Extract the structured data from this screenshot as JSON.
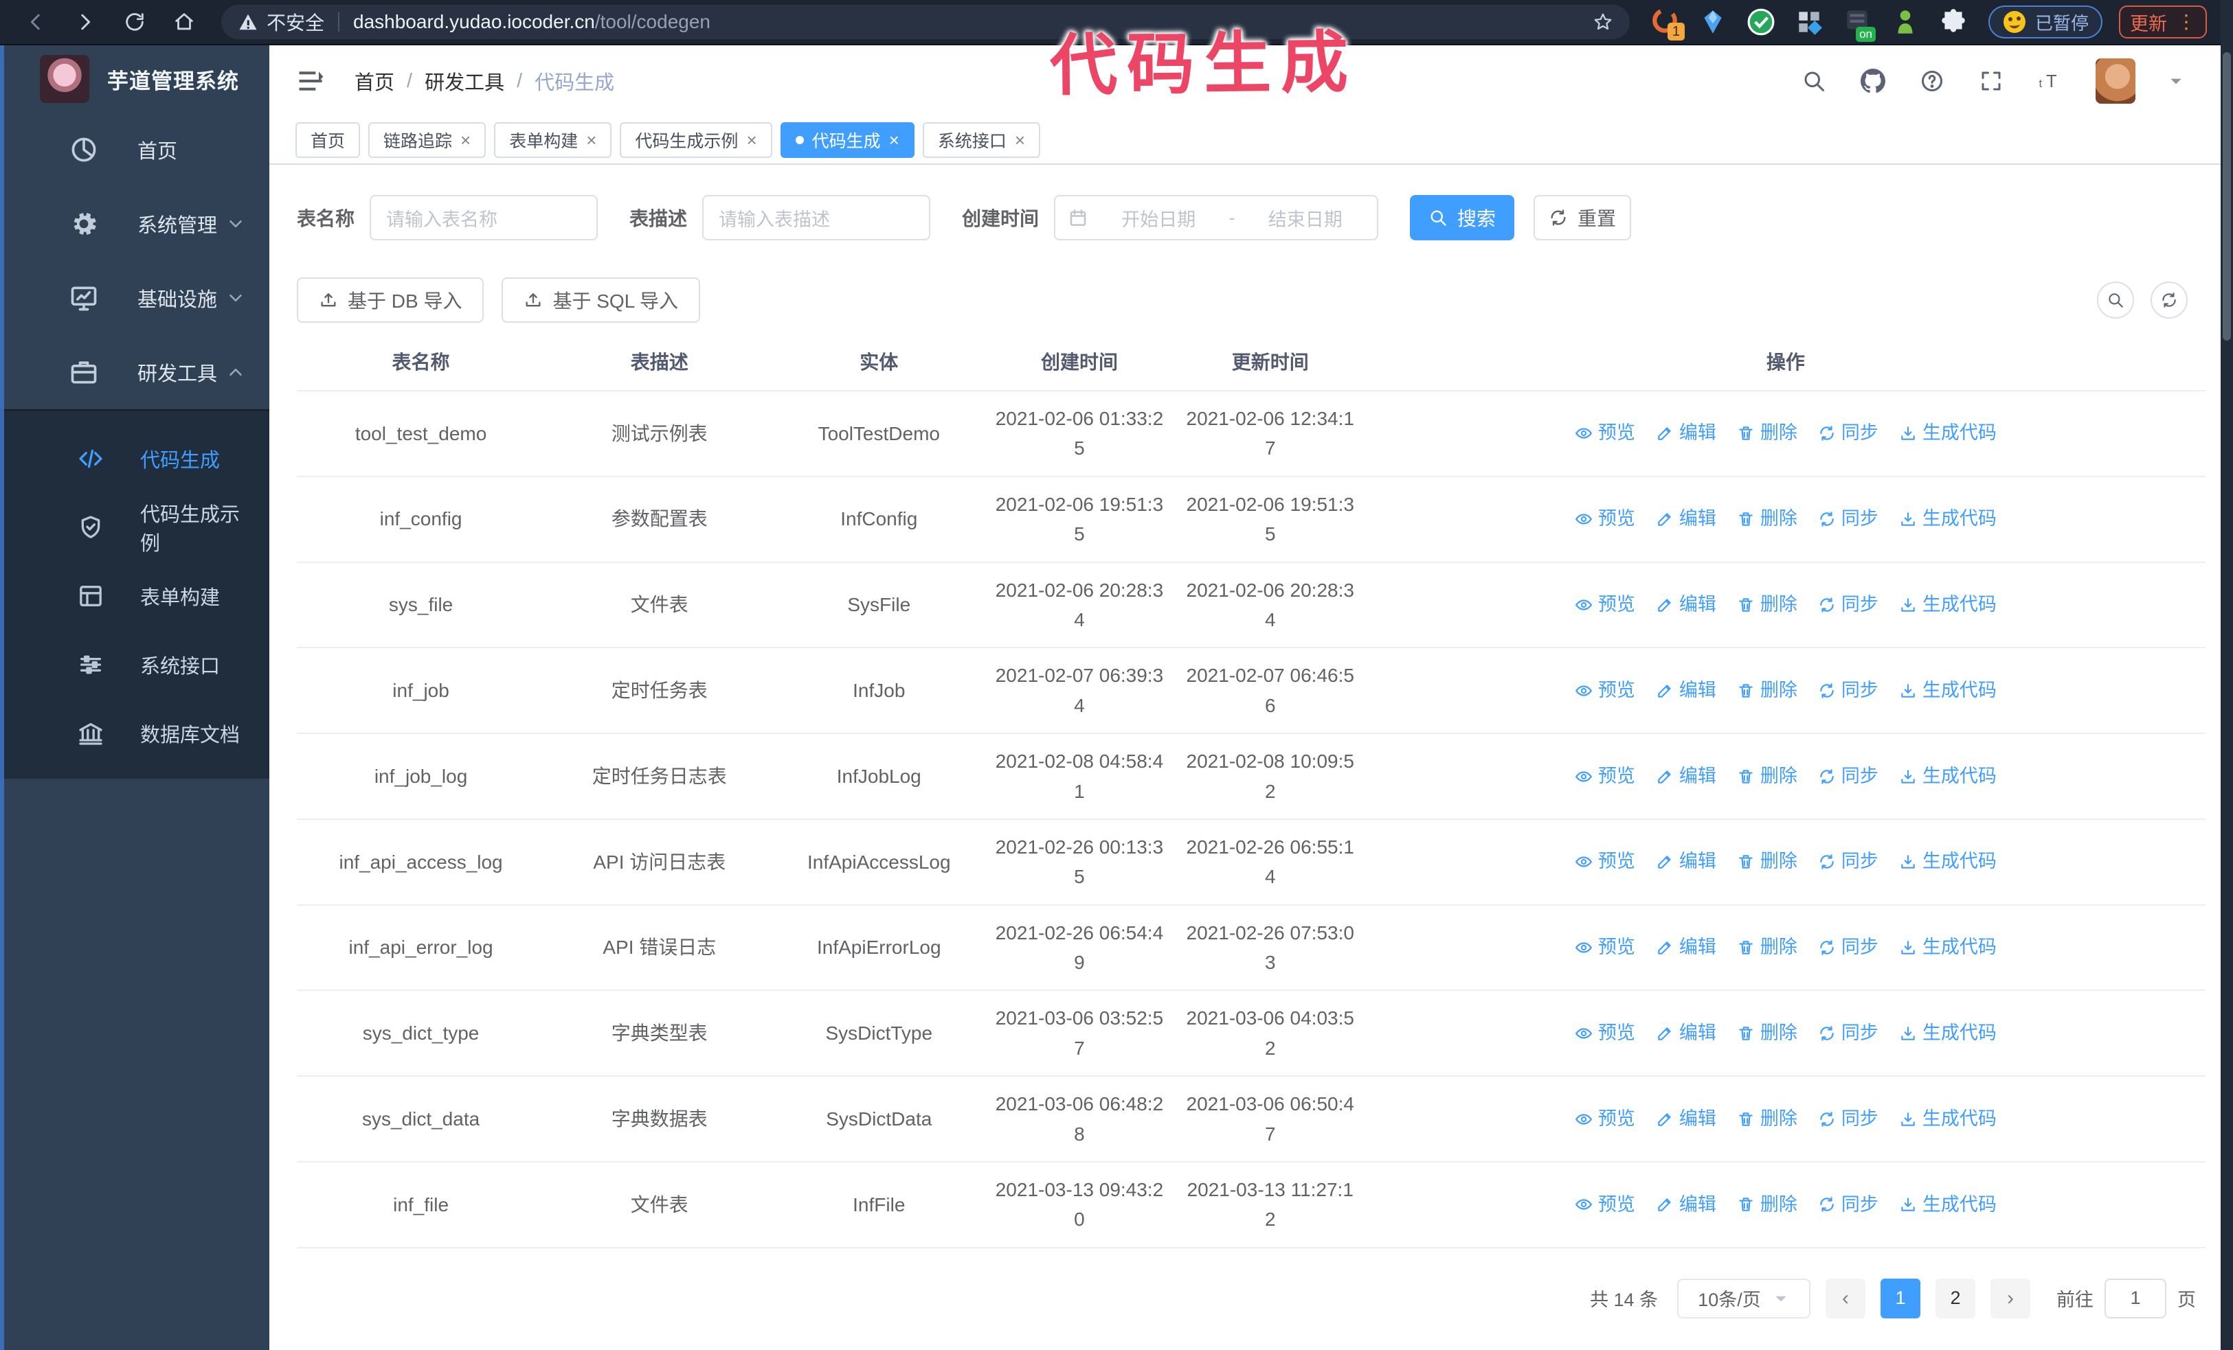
{
  "annotation": {
    "text": "代码生成"
  },
  "browser": {
    "security_label": "不安全",
    "url_host": "dashboard.yudao.iocoder.cn",
    "url_path": "/tool/codegen",
    "extensions": {
      "badge_count": "1",
      "on_label": "on"
    },
    "paused_label": "已暂停",
    "update_label": "更新"
  },
  "sidebar": {
    "logo_title": "芋道管理系统",
    "items": [
      {
        "label": "首页",
        "icon": "dashboard"
      },
      {
        "label": "系统管理",
        "icon": "gear",
        "chevron": "down"
      },
      {
        "label": "基础设施",
        "icon": "monitor",
        "chevron": "down"
      },
      {
        "label": "研发工具",
        "icon": "briefcase",
        "chevron": "up"
      }
    ],
    "submenu": [
      {
        "label": "代码生成",
        "icon": "code",
        "active": true
      },
      {
        "label": "代码生成示例",
        "icon": "shield",
        "active": false
      },
      {
        "label": "表单构建",
        "icon": "form",
        "active": false
      },
      {
        "label": "系统接口",
        "icon": "sliders",
        "active": false
      },
      {
        "label": "数据库文档",
        "icon": "bank",
        "active": false
      }
    ]
  },
  "header": {
    "breadcrumb": [
      "首页",
      "研发工具",
      "代码生成"
    ]
  },
  "tabs": [
    {
      "label": "首页",
      "closable": false,
      "active": false
    },
    {
      "label": "链路追踪",
      "closable": true,
      "active": false
    },
    {
      "label": "表单构建",
      "closable": true,
      "active": false
    },
    {
      "label": "代码生成示例",
      "closable": true,
      "active": false
    },
    {
      "label": "代码生成",
      "closable": true,
      "active": true
    },
    {
      "label": "系统接口",
      "closable": true,
      "active": false
    }
  ],
  "filters": {
    "name_label": "表名称",
    "name_placeholder": "请输入表名称",
    "desc_label": "表描述",
    "desc_placeholder": "请输入表描述",
    "time_label": "创建时间",
    "start_placeholder": "开始日期",
    "range_separator": "-",
    "end_placeholder": "结束日期",
    "search_label": "搜索",
    "reset_label": "重置"
  },
  "toolbar": {
    "db_import_label": "基于 DB 导入",
    "sql_import_label": "基于 SQL 导入"
  },
  "table": {
    "columns": [
      "表名称",
      "表描述",
      "实体",
      "创建时间",
      "更新时间",
      "操作"
    ],
    "action_labels": [
      "预览",
      "编辑",
      "删除",
      "同步",
      "生成代码"
    ],
    "action_icons": [
      "eye",
      "edit",
      "trash",
      "sync",
      "download"
    ],
    "rows": [
      {
        "name": "tool_test_demo",
        "desc": "测试示例表",
        "entity": "ToolTestDemo",
        "created": "2021-02-06 01:33:25",
        "updated": "2021-02-06 12:34:17"
      },
      {
        "name": "inf_config",
        "desc": "参数配置表",
        "entity": "InfConfig",
        "created": "2021-02-06 19:51:35",
        "updated": "2021-02-06 19:51:35"
      },
      {
        "name": "sys_file",
        "desc": "文件表",
        "entity": "SysFile",
        "created": "2021-02-06 20:28:34",
        "updated": "2021-02-06 20:28:34"
      },
      {
        "name": "inf_job",
        "desc": "定时任务表",
        "entity": "InfJob",
        "created": "2021-02-07 06:39:34",
        "updated": "2021-02-07 06:46:56"
      },
      {
        "name": "inf_job_log",
        "desc": "定时任务日志表",
        "entity": "InfJobLog",
        "created": "2021-02-08 04:58:41",
        "updated": "2021-02-08 10:09:52"
      },
      {
        "name": "inf_api_access_log",
        "desc": "API 访问日志表",
        "entity": "InfApiAccessLog",
        "created": "2021-02-26 00:13:35",
        "updated": "2021-02-26 06:55:14"
      },
      {
        "name": "inf_api_error_log",
        "desc": "API 错误日志",
        "entity": "InfApiErrorLog",
        "created": "2021-02-26 06:54:49",
        "updated": "2021-02-26 07:53:03"
      },
      {
        "name": "sys_dict_type",
        "desc": "字典类型表",
        "entity": "SysDictType",
        "created": "2021-03-06 03:52:57",
        "updated": "2021-03-06 04:03:52"
      },
      {
        "name": "sys_dict_data",
        "desc": "字典数据表",
        "entity": "SysDictData",
        "created": "2021-03-06 06:48:28",
        "updated": "2021-03-06 06:50:47"
      },
      {
        "name": "inf_file",
        "desc": "文件表",
        "entity": "InfFile",
        "created": "2021-03-13 09:43:20",
        "updated": "2021-03-13 11:27:12"
      }
    ]
  },
  "pagination": {
    "total_label": "共 14 条",
    "page_size_label": "10条/页",
    "pages": [
      "1",
      "2"
    ],
    "active_page": "1",
    "goto_label": "前往",
    "goto_value": "1",
    "page_suffix": "页"
  },
  "colors": {
    "primary": "#409eff",
    "sidebar_bg": "#304156",
    "submenu_bg": "#1f2d3d",
    "annotation_pink": "#ec4566",
    "browser_bar_bg": "#1c2431",
    "update_red": "#ef6a50"
  }
}
